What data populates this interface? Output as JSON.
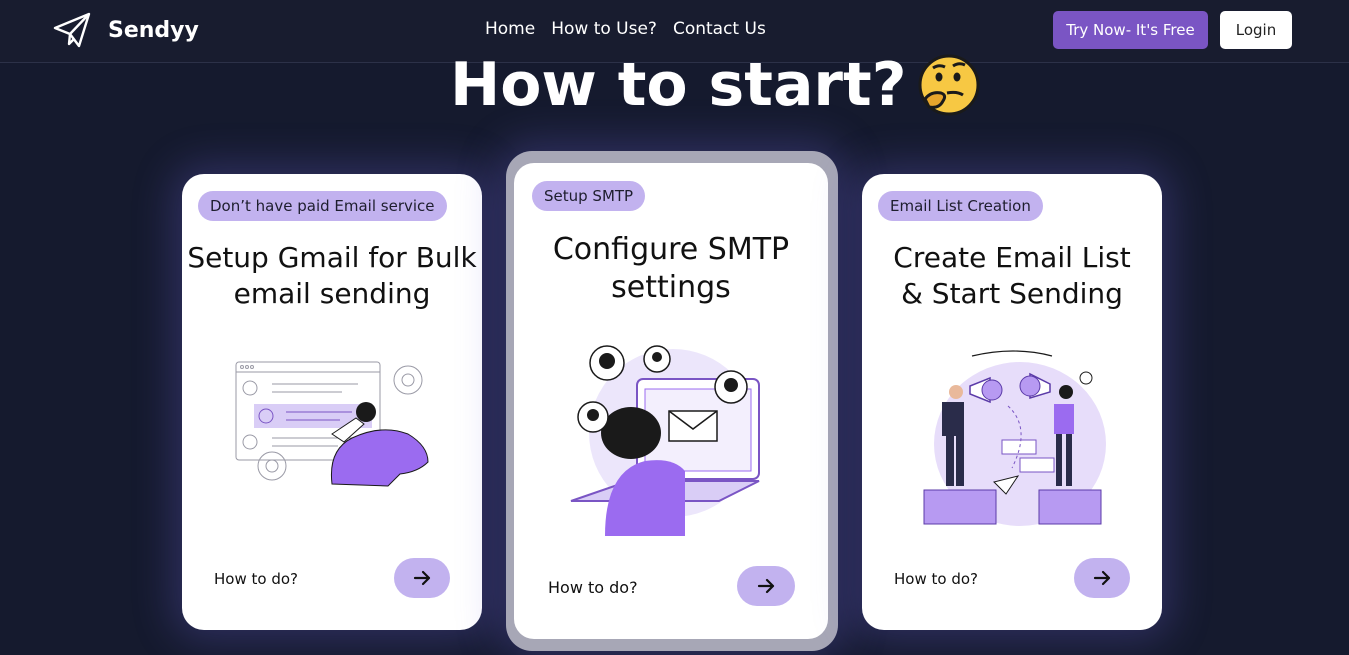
{
  "navbar": {
    "logo_text": "Sendyy",
    "links": [
      "Home",
      "How to Use?",
      "Contact Us"
    ],
    "try_button": "Try Now- It's Free",
    "login_button": "Login"
  },
  "hero": {
    "heading": "How to start?"
  },
  "cards": [
    {
      "badge": "Don’t have paid Email service",
      "title": "Setup Gmail for Bulk email sending",
      "cta": "How to do?"
    },
    {
      "badge": "Setup SMTP",
      "title": "Configure SMTP settings",
      "cta": "How to do?"
    },
    {
      "badge": "Email List Creation",
      "title": "Create Email List & Start Sending",
      "cta": "How to do?"
    }
  ],
  "icons": {
    "logo": "paper-plane-icon",
    "heading_emoji": "thinking-face-icon",
    "arrow": "arrow-right-icon"
  },
  "colors": {
    "background": "#151a2e",
    "accent": "#7a55c4",
    "badge": "#c2b2ef"
  }
}
